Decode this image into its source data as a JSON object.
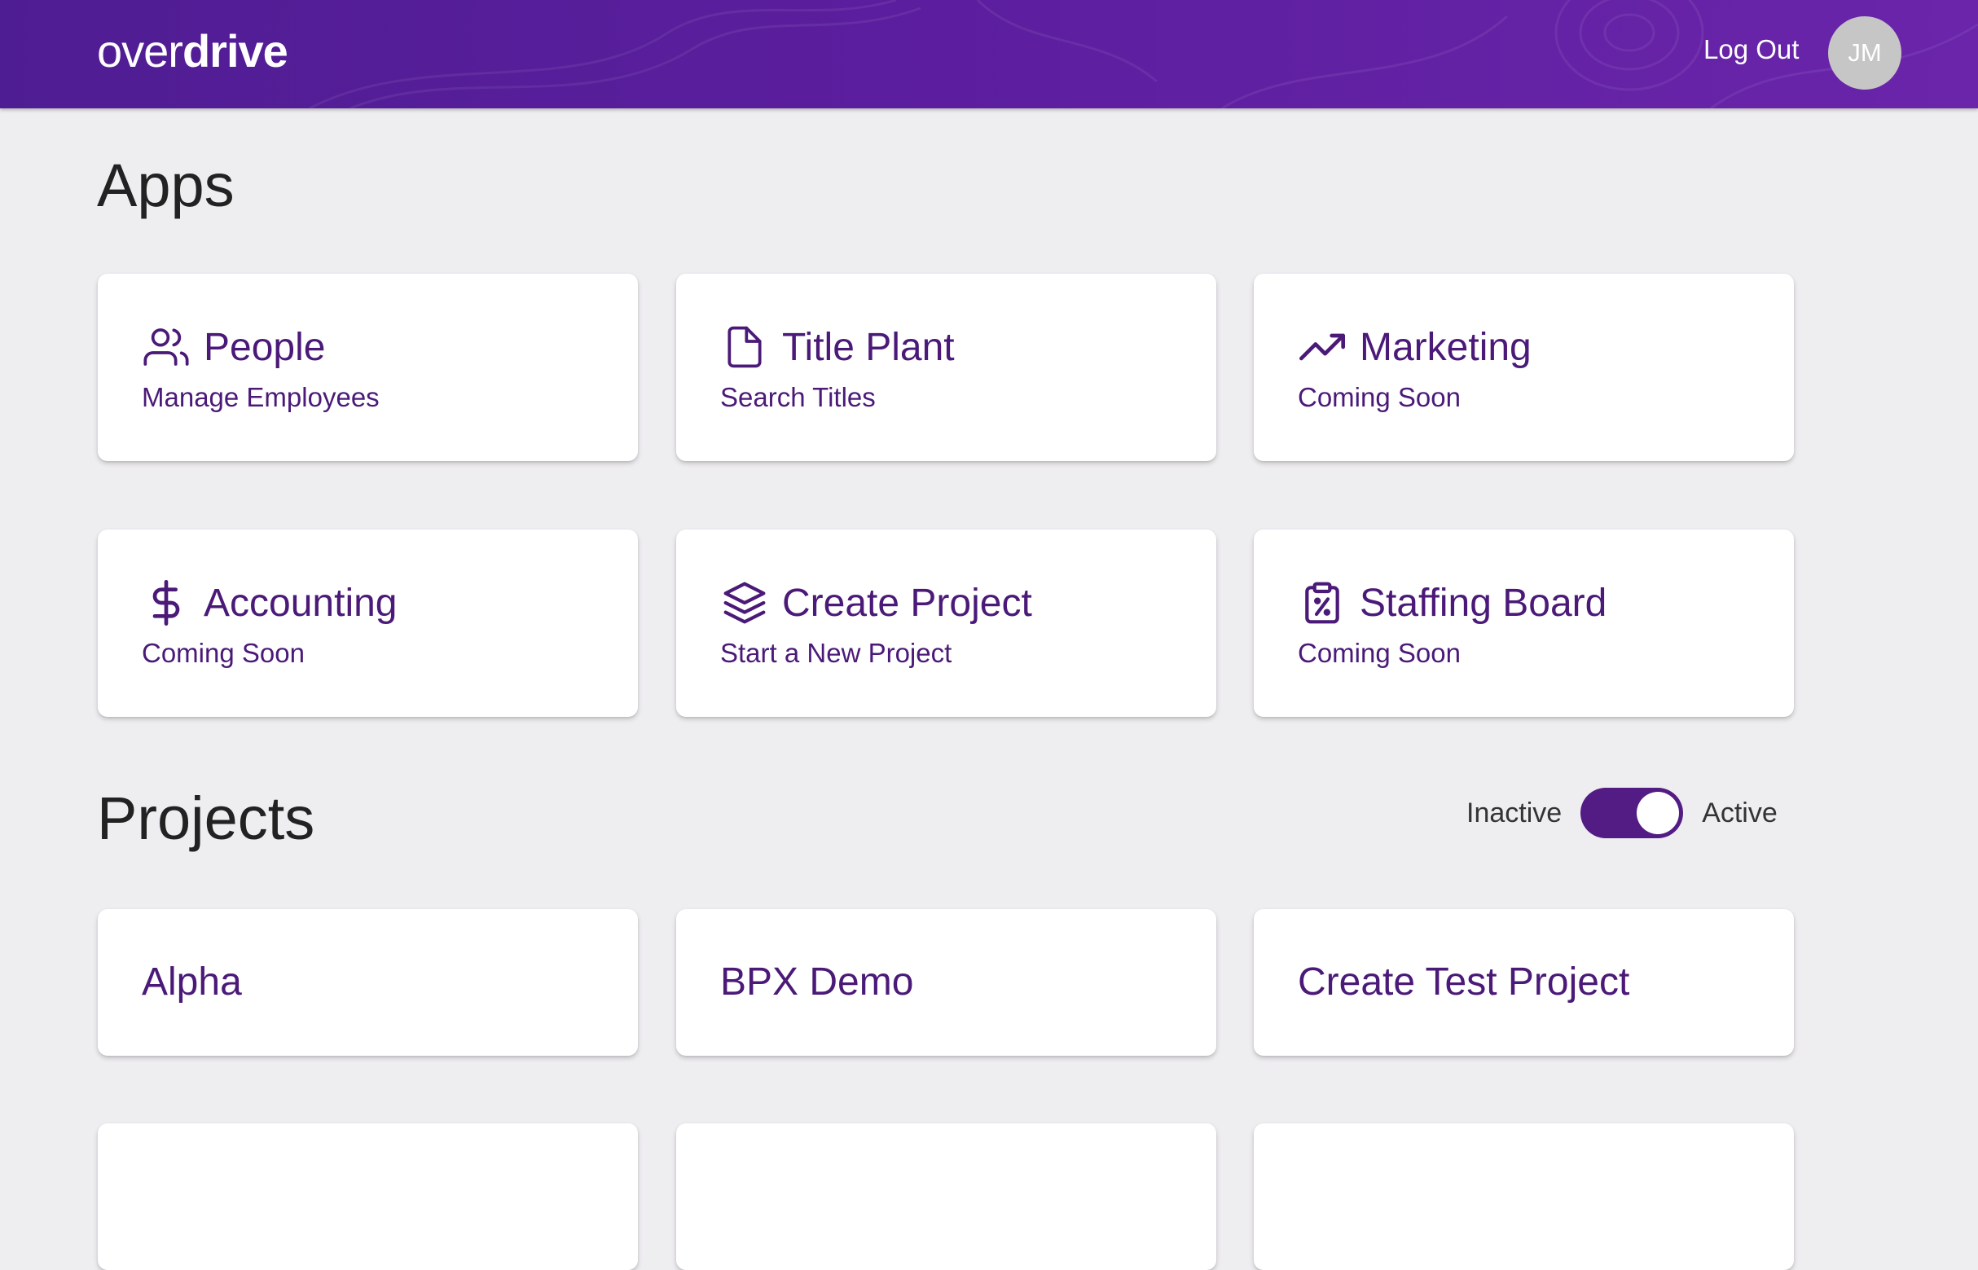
{
  "header": {
    "logo_light": "over",
    "logo_bold": "drive",
    "logout_label": "Log Out",
    "avatar_initials": "JM"
  },
  "apps": {
    "title": "Apps",
    "items": [
      {
        "title": "People",
        "subtitle": "Manage Employees",
        "icon": "people-icon"
      },
      {
        "title": "Title Plant",
        "subtitle": "Search Titles",
        "icon": "document-icon"
      },
      {
        "title": "Marketing",
        "subtitle": "Coming Soon",
        "icon": "trending-up-icon"
      },
      {
        "title": "Accounting",
        "subtitle": "Coming Soon",
        "icon": "dollar-icon"
      },
      {
        "title": "Create Project",
        "subtitle": "Start a New Project",
        "icon": "layers-icon"
      },
      {
        "title": "Staffing Board",
        "subtitle": "Coming Soon",
        "icon": "clipboard-percent-icon"
      }
    ]
  },
  "projects": {
    "title": "Projects",
    "toggle": {
      "off_label": "Inactive",
      "on_label": "Active",
      "state": "active"
    },
    "items": [
      {
        "title": "Alpha"
      },
      {
        "title": "BPX Demo"
      },
      {
        "title": "Create Test Project"
      },
      {
        "title": ""
      },
      {
        "title": ""
      },
      {
        "title": ""
      }
    ]
  },
  "colors": {
    "header_purple": "#5b1e9e",
    "card_text": "#4b1a78",
    "toggle_on": "#531c84",
    "background": "#eeedf0"
  }
}
